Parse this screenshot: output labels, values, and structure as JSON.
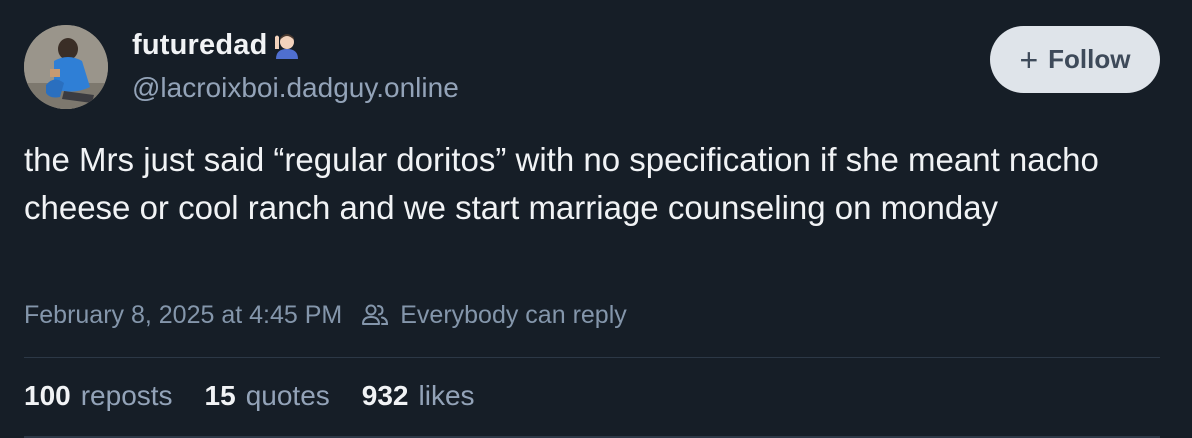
{
  "author": {
    "display_name": "futuredad",
    "handle": "@lacroixboi.dadguy.online",
    "emoji_icon": "waving-hand-person-icon",
    "avatar_icon": "avatar-photo"
  },
  "follow_button": {
    "plus": "+",
    "label": "Follow"
  },
  "post": {
    "text": "the Mrs just said “regular doritos” with no specification if she meant nacho cheese or cool ranch and we start marriage counseling on monday"
  },
  "meta": {
    "timestamp": "February 8, 2025 at 4:45 PM",
    "reply_setting": "Everybody can reply",
    "reply_icon": "people-icon"
  },
  "stats": [
    {
      "count": "100",
      "label": "reposts"
    },
    {
      "count": "15",
      "label": "quotes"
    },
    {
      "count": "932",
      "label": "likes"
    }
  ],
  "colors": {
    "background": "#161e27",
    "text": "#f1f3f5",
    "muted": "#93a3b8",
    "button_bg": "#dfe4ea",
    "button_text": "#3e4a5a"
  }
}
